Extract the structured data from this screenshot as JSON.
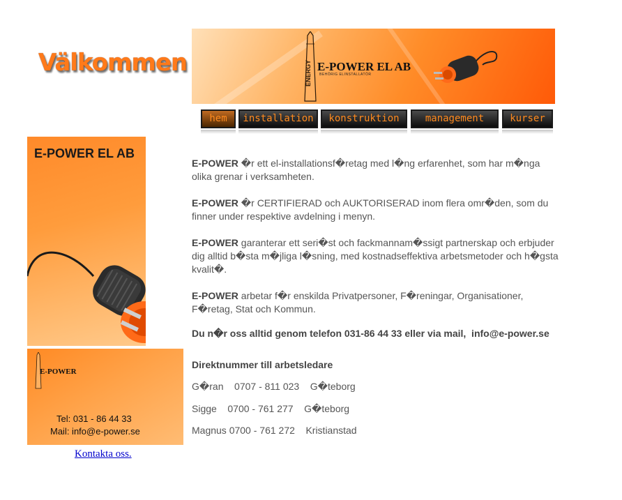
{
  "welcome_text": "Välkommen",
  "banner": {
    "logo_tower_text": "ENERGY",
    "brand": "E-POWER EL AB",
    "tagline": "BEHÖRIG ELINSTALLATÖR"
  },
  "nav": [
    {
      "label": "hem"
    },
    {
      "label": "installation"
    },
    {
      "label": "konstruktion"
    },
    {
      "label": "management"
    },
    {
      "label": "kurser"
    }
  ],
  "sidebar": {
    "card_title": "E-POWER EL AB",
    "mini_brand": "E-POWER",
    "tel": "Tel: 031 - 86 44 33",
    "mail": "Mail: info@e-power.se",
    "contact_link": "Kontakta oss."
  },
  "main": {
    "p1_bold": "E-POWER",
    "p1_text": " �r ett el-installationsf�retag med l�ng erfarenhet, som har m�nga olika grenar i verksamheten.",
    "p2_bold": "E-POWER",
    "p2_text": " �r CERTIFIERAD och AUKTORISERAD inom flera omr�den, som du finner under respektive avdelning i menyn.",
    "p3_bold": "E-POWER",
    "p3_text": " garanterar ett seri�st och fackmannam�ssigt partnerskap och erbjuder dig alltid b�sta m�jliga l�sning, med kostnadseffektiva arbetsmetoder och h�gsta kvalit�.",
    "p4_bold": "E-POWER",
    "p4_text": " arbetar f�r enskilda Privatpersoner, F�reningar, Organisationer, F�retag, Stat och Kommun.",
    "contact_line": "Du n�r oss alltid genom telefon 031-86 44 33 eller via mail,  info@e-power.se",
    "direct_heading": "Direktnummer till arbetsledare",
    "contacts": [
      "G�ran    0707 - 811 023    G�teborg",
      "Sigge    0700 - 761 277    G�teborg",
      "Magnus 0700 - 761 272    Kristianstad"
    ]
  }
}
